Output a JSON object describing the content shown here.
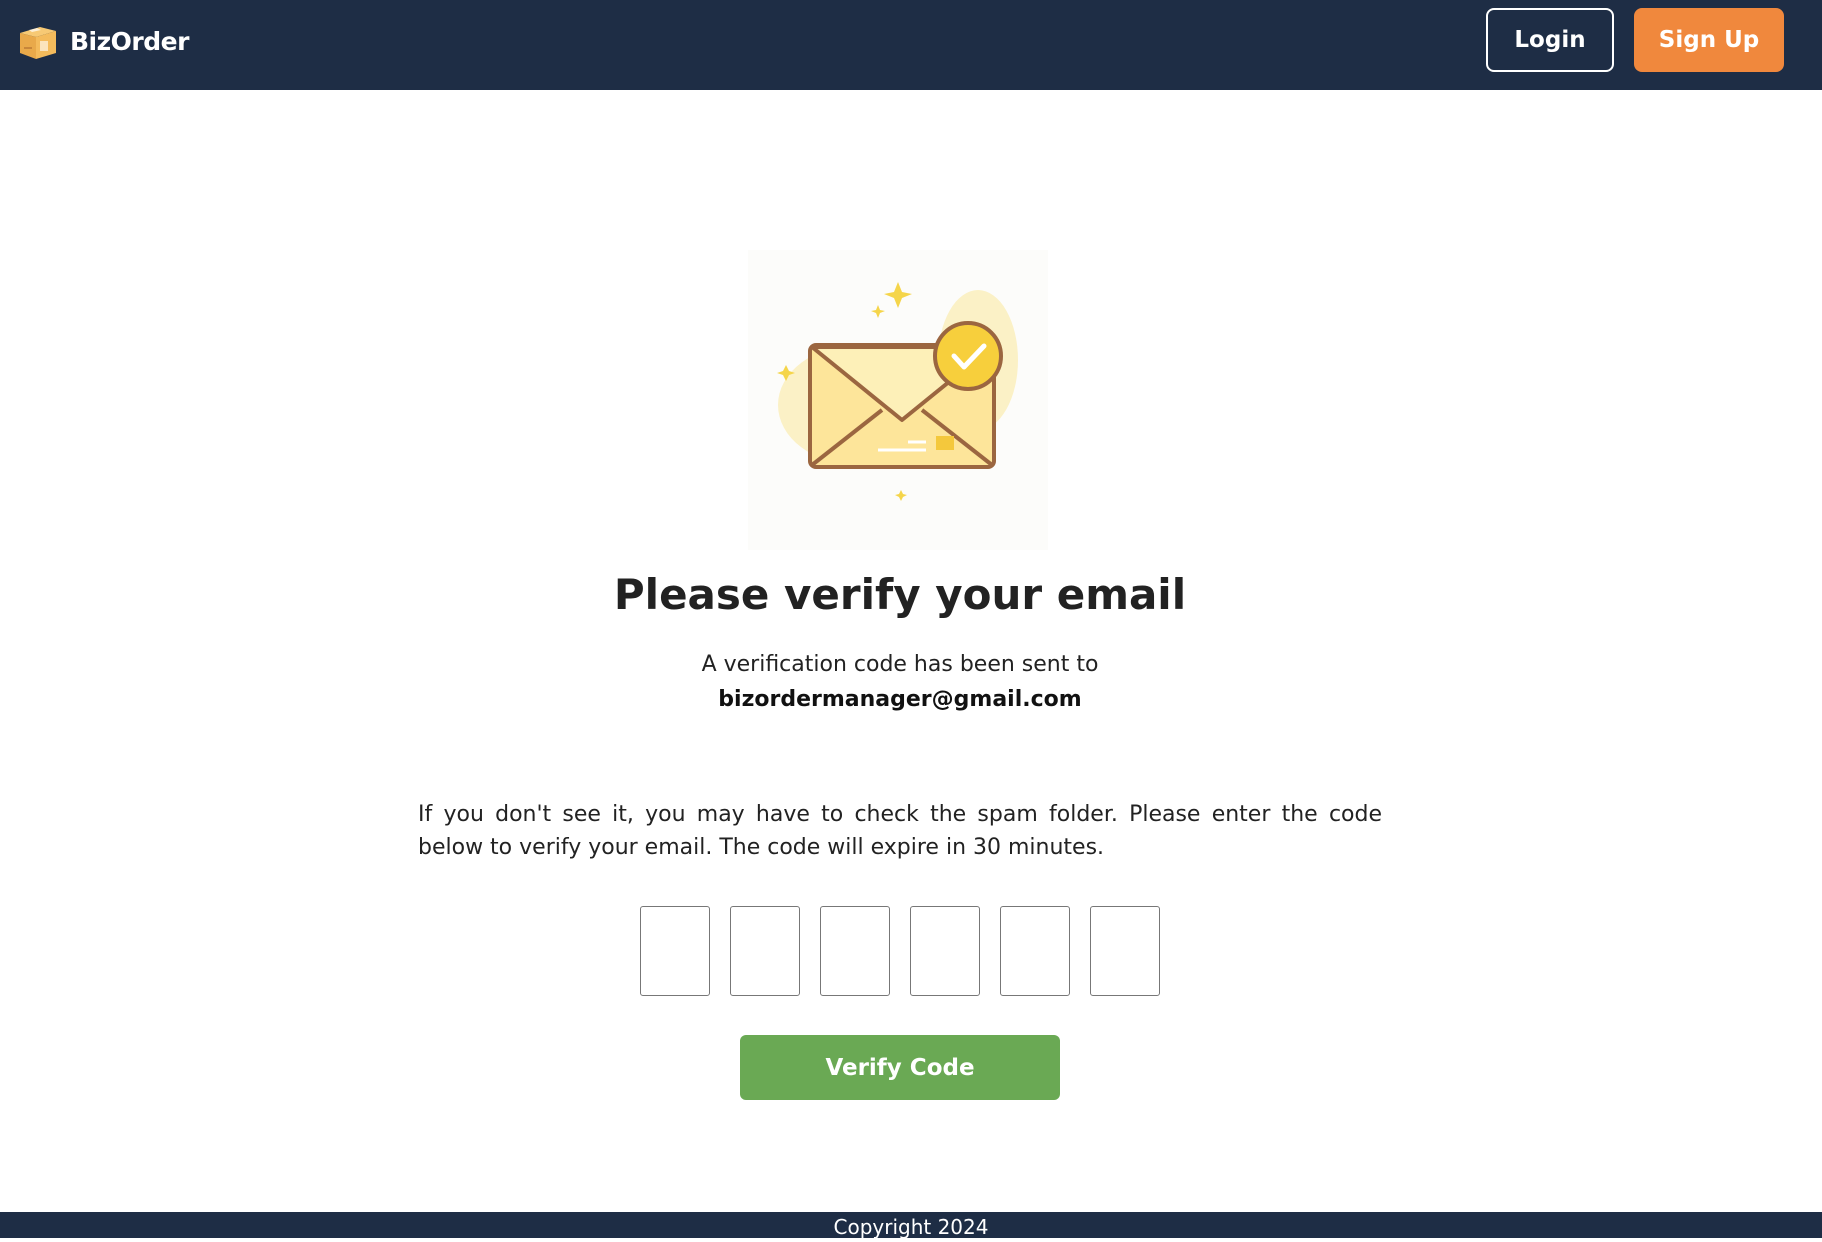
{
  "header": {
    "brand_name": "BizOrder",
    "logo_icon": "box-icon",
    "login_label": "Login",
    "signup_label": "Sign Up"
  },
  "main": {
    "illustration_icon": "envelope-check-icon",
    "title": "Please verify your email",
    "sent_text": "A verification code has been sent to",
    "email": "bizordermanager@gmail.com",
    "instructions": "If you don't see it, you may have to check the spam folder. Please enter the code below to verify your email. The code will expire in 30 minutes.",
    "code_digits": [
      "",
      "",
      "",
      "",
      "",
      ""
    ],
    "verify_label": "Verify Code"
  },
  "footer": {
    "copyright": "Copyright 2024"
  },
  "colors": {
    "navbar": "#1e2d45",
    "signup_button": "#f0883d",
    "verify_button": "#6aa954"
  }
}
